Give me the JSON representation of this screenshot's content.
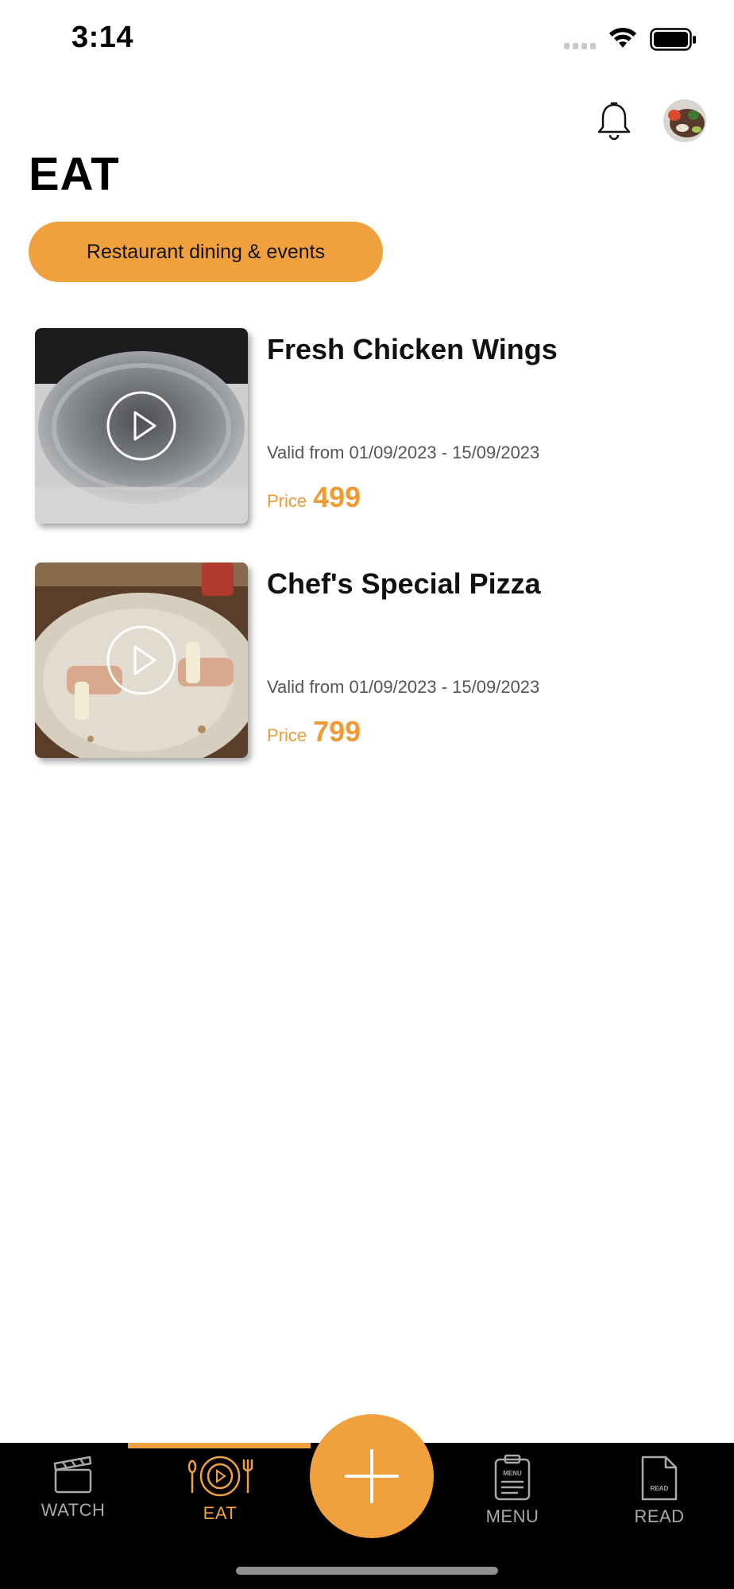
{
  "status_bar": {
    "time": "3:14"
  },
  "header": {
    "title": "EAT"
  },
  "filter": {
    "label": "Restaurant dining & events"
  },
  "items": [
    {
      "title": "Fresh Chicken Wings",
      "valid": "Valid from 01/09/2023 - 15/09/2023",
      "price_label": "Price",
      "price": "499"
    },
    {
      "title": "Chef's Special Pizza",
      "valid": "Valid from 01/09/2023 - 15/09/2023",
      "price_label": "Price",
      "price": "799"
    }
  ],
  "tabs": [
    {
      "label": "WATCH",
      "icon": "clapperboard-icon"
    },
    {
      "label": "EAT",
      "icon": "plate-play-icon"
    },
    {
      "label": "MENU",
      "icon": "menu-clipboard-icon"
    },
    {
      "label": "READ",
      "icon": "read-document-icon"
    }
  ],
  "colors": {
    "accent": "#F0A13D",
    "tabbar_bg": "#000000",
    "inactive_tab": "#A9A9A9"
  }
}
